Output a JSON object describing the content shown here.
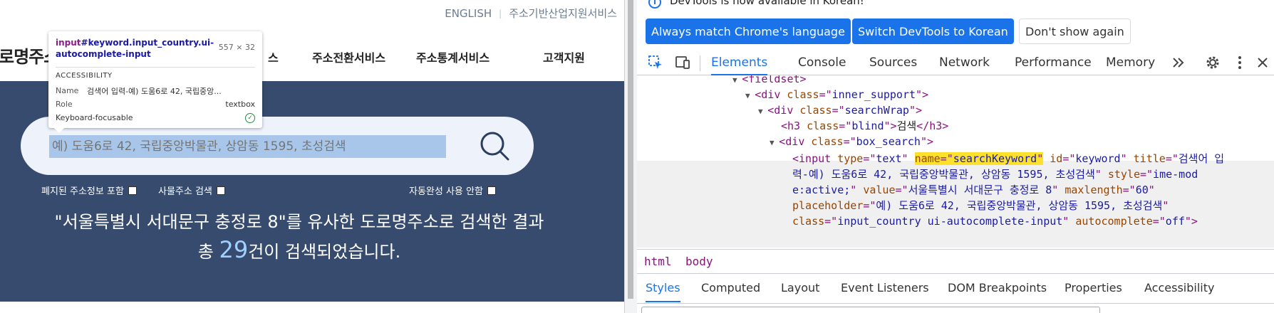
{
  "site": {
    "top_links": [
      "ENGLISH",
      "주소기반산업지원서비스"
    ],
    "logo_partial": "로명주소",
    "nav": [
      "스",
      "주소전환서비스",
      "주소통계서비스",
      "고객지원"
    ],
    "search": {
      "placeholder": "예) 도움6로 42, 국립중앙박물관, 상암동 1595, 초성검색"
    },
    "options": {
      "include_abolished": "폐지된 주소정보 포함",
      "po_box": "사물주소 검색",
      "autocomplete_off": "자동완성 사용 안함"
    },
    "result": {
      "line1": "\"서울특별시 서대문구 충정로 8\"를 유사한 도로명주소로 검색한 결과",
      "prefix": "총 ",
      "count": "29",
      "suffix": "건이 검색되었습니다."
    }
  },
  "tooltip": {
    "selector_tag": "input",
    "selector_rest": "#keyword.input_country.ui-autocomplete-input",
    "size": "557 × 32",
    "section": "ACCESSIBILITY",
    "name_label": "Name",
    "name_value": "검색어 입력-예) 도움6로 42, 국립중앙...",
    "role_label": "Role",
    "role_value": "textbox",
    "focus_label": "Keyboard-focusable"
  },
  "devtools": {
    "infobar": {
      "message": "DevTools is now available in Korean!",
      "btn_match": "Always match Chrome's language",
      "btn_switch": "Switch DevTools to Korean",
      "btn_dismiss": "Don't show again"
    },
    "tabs": [
      "Elements",
      "Console",
      "Sources",
      "Network",
      "Performance",
      "Memory"
    ],
    "active_tab": "Elements",
    "dom": {
      "l1_tag": "<fieldset>",
      "l2_class": "inner_support",
      "l3_class": "searchWrap",
      "l4_class": "blind",
      "l4_text": "검색",
      "l5_class": "box_search",
      "input_type": "text",
      "input_name": "searchKeyword",
      "input_id": "keyword",
      "input_title_a": "검색어 입",
      "input_title_b": "력-예) 도움6로 42, 국립중앙박물관, 상암동 1595, 초성검색",
      "input_style_a": "ime-mod",
      "input_style_b": "e:active;",
      "input_value": "서울특별시 서대문구 충정로 8",
      "input_maxlength": "60",
      "input_placeholder": "예) 도움6로 42, 국립중앙박물관, 상암동 1595, 초성검색",
      "input_class": "input_country ui-autocomplete-input",
      "input_autocomplete": "off"
    },
    "breadcrumbs": [
      "html",
      "body"
    ],
    "subtabs": [
      "Styles",
      "Computed",
      "Layout",
      "Event Listeners",
      "DOM Breakpoints",
      "Properties",
      "Accessibility"
    ],
    "active_subtab": "Styles"
  }
}
